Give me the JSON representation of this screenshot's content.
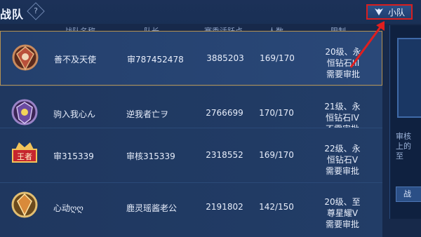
{
  "header": {
    "title": "战队",
    "help_icon": "?",
    "squad_button": "小队"
  },
  "columns": [
    "战队名称",
    "队长",
    "赛季活跃点",
    "人数",
    "限制"
  ],
  "rows": [
    {
      "badge": "bronze-crest-icon",
      "name": "善不及天使",
      "captain": "审787452478",
      "points": "3885203",
      "members": "169/170",
      "limit1": "20级、永恒钻石III",
      "limit2": "需要审批",
      "selected": true
    },
    {
      "badge": "purple-shield-icon",
      "name": "驹入我心ん",
      "captain": "逆我者亡ヲ",
      "points": "2766699",
      "members": "170/170",
      "limit1": "21级、永恒钻石IV",
      "limit2": "不需审批",
      "selected": false
    },
    {
      "badge": "king-crown-icon",
      "name": "审315339",
      "captain": "审核315339",
      "points": "2318552",
      "members": "169/170",
      "limit1": "22级、永恒钻石V",
      "limit2": "需要审批",
      "selected": false
    },
    {
      "badge": "gold-crest-icon",
      "name": "心动ღღ",
      "captain": "鹿灵瑶酱老公",
      "points": "2191802",
      "members": "142/150",
      "limit1": "20级、至尊星耀V",
      "limit2": "需要审批",
      "selected": false
    }
  ],
  "side_panel": {
    "line1": "审核",
    "line2": "上的",
    "line3": "至",
    "button": "战"
  }
}
